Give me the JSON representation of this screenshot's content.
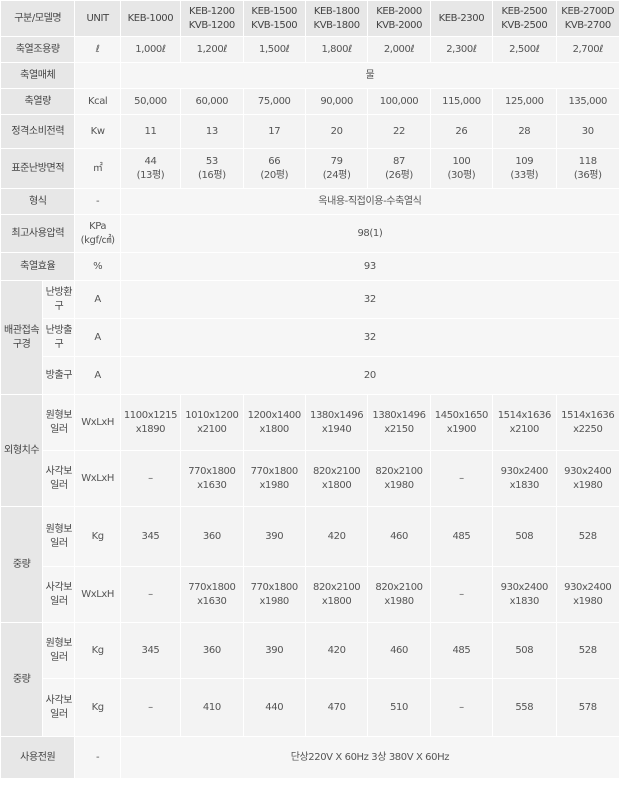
{
  "header": {
    "category_label": "구분/모델명",
    "unit_label": "UNIT",
    "models": [
      [
        "KEB-1000"
      ],
      [
        "KEB-1200",
        "KVB-1200"
      ],
      [
        "KEB-1500",
        "KVB-1500"
      ],
      [
        "KEB-1800",
        "KVB-1800"
      ],
      [
        "KEB-2000",
        "KVB-2000"
      ],
      [
        "KEB-2300"
      ],
      [
        "KEB-2500",
        "KVB-2500"
      ],
      [
        "KEB-2700D",
        "KVB-2700"
      ]
    ]
  },
  "rows": {
    "capacity": {
      "label": "축열조용량",
      "unit": "ℓ",
      "values": [
        "1,000ℓ",
        "1,200ℓ",
        "1,500ℓ",
        "1,800ℓ",
        "2,000ℓ",
        "2,300ℓ",
        "2,500ℓ",
        "2,700ℓ"
      ]
    },
    "medium": {
      "label": "축열매체",
      "unit": "",
      "value": "물"
    },
    "heat": {
      "label": "축열량",
      "unit": "Kcal",
      "values": [
        "50,000",
        "60,000",
        "75,000",
        "90,000",
        "100,000",
        "115,000",
        "125,000",
        "135,000"
      ]
    },
    "power": {
      "label": "정격소비전력",
      "unit": "Kw",
      "values": [
        "11",
        "13",
        "17",
        "20",
        "22",
        "26",
        "28",
        "30"
      ]
    },
    "area": {
      "label": "표준난방면적",
      "unit": "㎡",
      "values": [
        [
          "44",
          "(13평)"
        ],
        [
          "53",
          "(16평)"
        ],
        [
          "66",
          "(20평)"
        ],
        [
          "79",
          "(24평)"
        ],
        [
          "87",
          "(26평)"
        ],
        [
          "100",
          "(30평)"
        ],
        [
          "109",
          "(33평)"
        ],
        [
          "118",
          "(36평)"
        ]
      ]
    },
    "type": {
      "label": "형식",
      "unit": "-",
      "value": "옥내용-직접이용-수축열식"
    },
    "pressure": {
      "label": "최고사용압력",
      "unit": [
        "KPa",
        "(kgf/㎠)"
      ],
      "value": "98(1)"
    },
    "efficiency": {
      "label": "축열효율",
      "unit": "%",
      "value": "93"
    },
    "pipe": {
      "label": "배관접속구경",
      "items": [
        {
          "label": "난방환구",
          "unit": "A",
          "value": "32"
        },
        {
          "label": "난방출구",
          "unit": "A",
          "value": "32"
        },
        {
          "label": "방출구",
          "unit": "A",
          "value": "20"
        }
      ]
    },
    "dimension": {
      "label": "외형치수",
      "items": [
        {
          "label": "원형보일러",
          "unit": "WxLxH",
          "values": [
            [
              "1100x1215",
              "x1890"
            ],
            [
              "1010x1200",
              "x2100"
            ],
            [
              "1200x1400",
              "x1800"
            ],
            [
              "1380x1496",
              "x1940"
            ],
            [
              "1380x1496",
              "x2150"
            ],
            [
              "1450x1650",
              "x1900"
            ],
            [
              "1514x1636",
              "x2100"
            ],
            [
              "1514x1636",
              "x2250"
            ]
          ]
        },
        {
          "label": "사각보일러",
          "unit": "WxLxH",
          "values": [
            [
              "–",
              ""
            ],
            [
              "770x1800",
              "x1630"
            ],
            [
              "770x1800",
              "x1980"
            ],
            [
              "820x2100",
              "x1800"
            ],
            [
              "820x2100",
              "x1980"
            ],
            [
              "–",
              ""
            ],
            [
              "930x2400",
              "x1830"
            ],
            [
              "930x2400",
              "x1980"
            ]
          ]
        }
      ]
    },
    "weight1": {
      "label": "중량",
      "items": [
        {
          "label": "원형보일러",
          "unit": "Kg",
          "values": [
            [
              "345",
              ""
            ],
            [
              "360",
              ""
            ],
            [
              "390",
              ""
            ],
            [
              "420",
              ""
            ],
            [
              "460",
              ""
            ],
            [
              "485",
              ""
            ],
            [
              "508",
              ""
            ],
            [
              "528",
              ""
            ]
          ]
        },
        {
          "label": "사각보일러",
          "unit": "WxLxH",
          "values": [
            [
              "–",
              ""
            ],
            [
              "770x1800",
              "x1630"
            ],
            [
              "770x1800",
              "x1980"
            ],
            [
              "820x2100",
              "x1800"
            ],
            [
              "820x2100",
              "x1980"
            ],
            [
              "–",
              ""
            ],
            [
              "930x2400",
              "x1830"
            ],
            [
              "930x2400",
              "x1980"
            ]
          ]
        }
      ]
    },
    "weight2": {
      "label": "중량",
      "items": [
        {
          "label": "원형보일러",
          "unit": "Kg",
          "values": [
            [
              "345",
              ""
            ],
            [
              "360",
              ""
            ],
            [
              "390",
              ""
            ],
            [
              "420",
              ""
            ],
            [
              "460",
              ""
            ],
            [
              "485",
              ""
            ],
            [
              "508",
              ""
            ],
            [
              "528",
              ""
            ]
          ]
        },
        {
          "label": "사각보일러",
          "unit": "Kg",
          "values": [
            [
              "–",
              ""
            ],
            [
              "410",
              ""
            ],
            [
              "440",
              ""
            ],
            [
              "470",
              ""
            ],
            [
              "510",
              ""
            ],
            [
              "–",
              ""
            ],
            [
              "558",
              ""
            ],
            [
              "578",
              ""
            ]
          ]
        }
      ]
    },
    "supply": {
      "label": "사용전원",
      "unit": "-",
      "value": "단상220V X 60Hz 3상 380V X 60Hz"
    }
  }
}
